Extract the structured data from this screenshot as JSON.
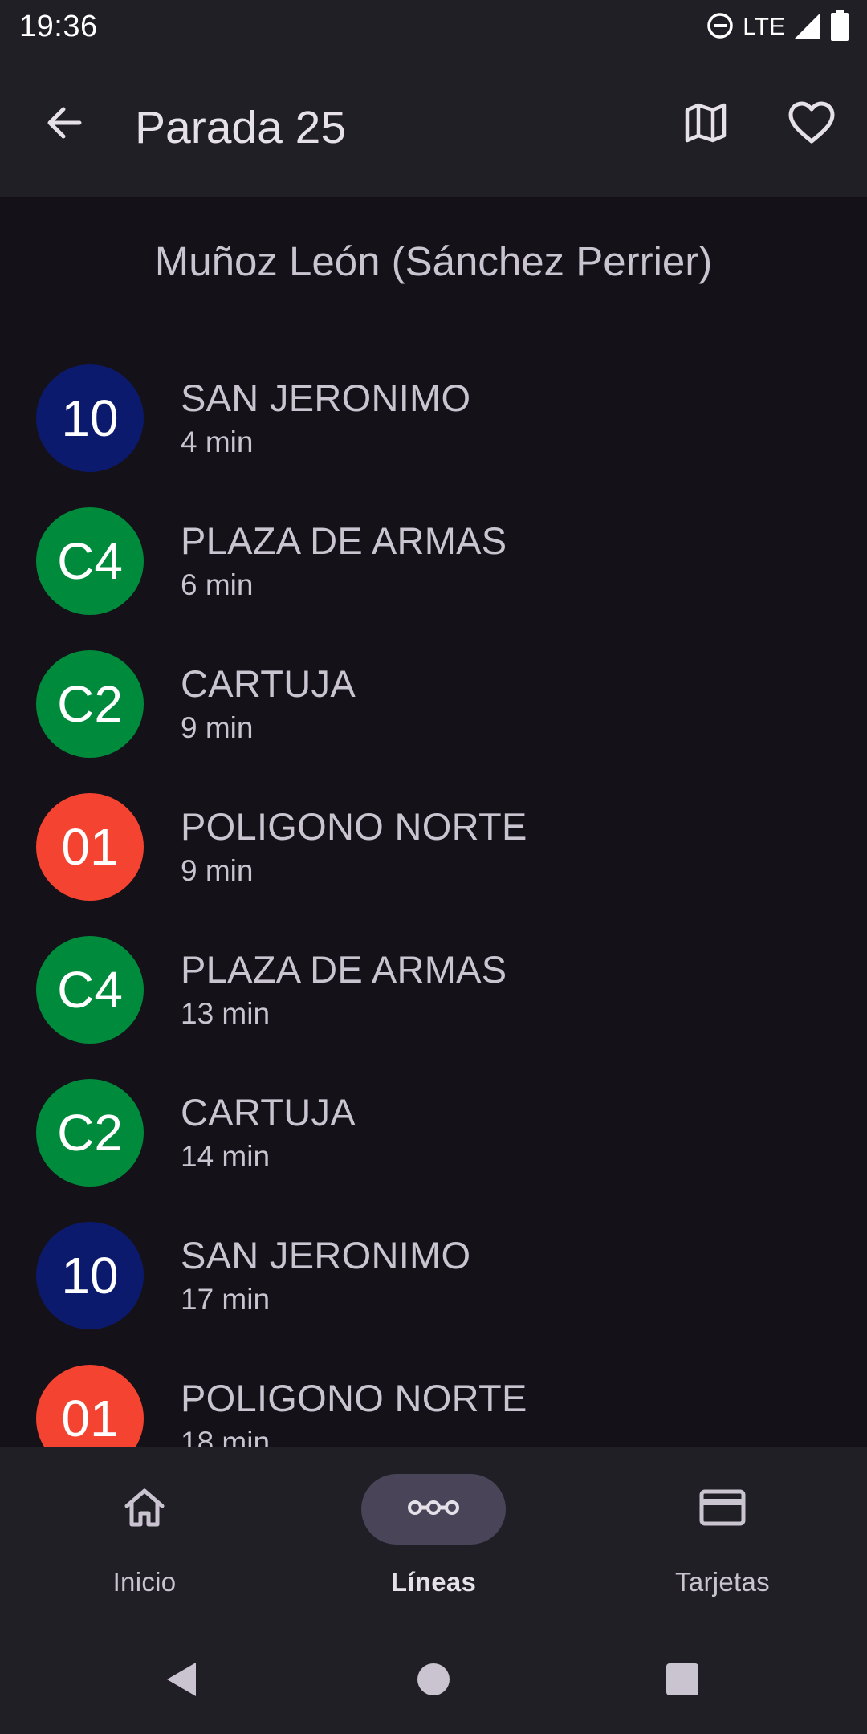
{
  "status_bar": {
    "time": "19:36",
    "network": "LTE",
    "icons": [
      "do-not-disturb-icon",
      "signal-icon",
      "battery-icon"
    ]
  },
  "app_bar": {
    "title": "Parada 25",
    "back_icon": "arrow-back-icon",
    "map_icon": "map-icon",
    "favorite_icon": "heart-outline-icon"
  },
  "stop": {
    "name": "Muñoz León (Sánchez Perrier)"
  },
  "arrivals": [
    {
      "line": "10",
      "destination": "SAN JERONIMO",
      "eta": "4 min",
      "color": "#0c1a6e"
    },
    {
      "line": "C4",
      "destination": "PLAZA DE ARMAS",
      "eta": "6 min",
      "color": "#008b3c"
    },
    {
      "line": "C2",
      "destination": "CARTUJA",
      "eta": "9 min",
      "color": "#008b3c"
    },
    {
      "line": "01",
      "destination": "POLIGONO NORTE",
      "eta": "9 min",
      "color": "#f44330"
    },
    {
      "line": "C4",
      "destination": "PLAZA DE ARMAS",
      "eta": "13 min",
      "color": "#008b3c"
    },
    {
      "line": "C2",
      "destination": "CARTUJA",
      "eta": "14 min",
      "color": "#008b3c"
    },
    {
      "line": "10",
      "destination": "SAN JERONIMO",
      "eta": "17 min",
      "color": "#0c1a6e"
    },
    {
      "line": "01",
      "destination": "POLIGONO NORTE",
      "eta": "18 min",
      "color": "#f44330"
    }
  ],
  "bottom_nav": {
    "items": [
      {
        "label": "Inicio",
        "icon": "home-icon",
        "active": false
      },
      {
        "label": "Líneas",
        "icon": "route-icon",
        "active": true
      },
      {
        "label": "Tarjetas",
        "icon": "credit-card-icon",
        "active": false
      }
    ]
  },
  "system_nav": {
    "icons": [
      "back-triangle-icon",
      "home-circle-icon",
      "recents-square-icon"
    ]
  },
  "colors": {
    "background": "#141218",
    "surface": "#211f26",
    "text": "#cac4d0",
    "active_indicator": "#4a4458"
  }
}
